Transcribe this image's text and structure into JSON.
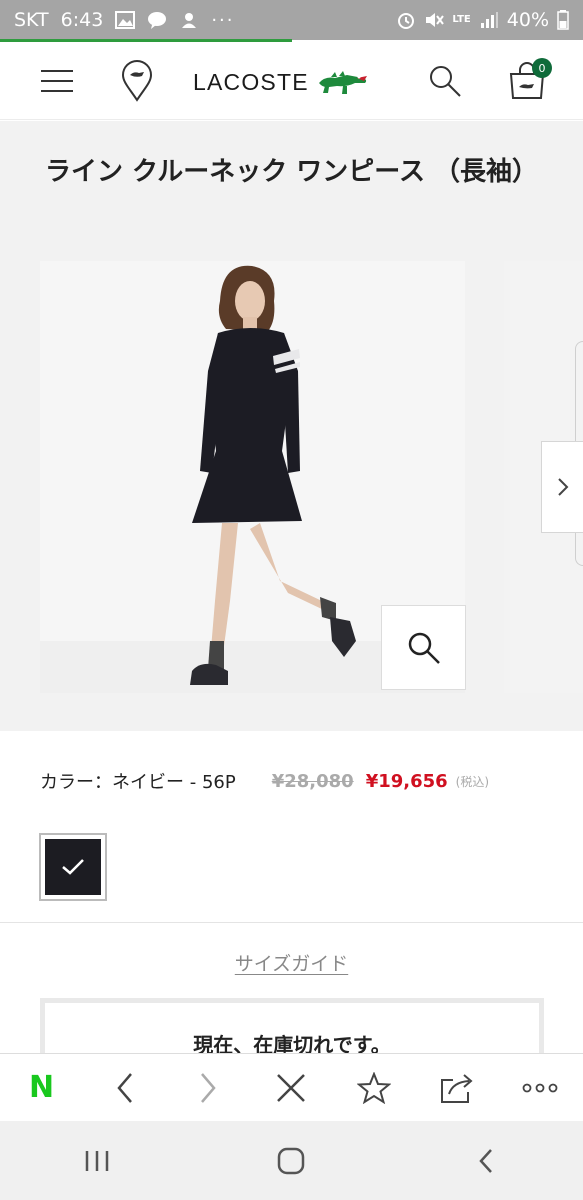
{
  "status_bar": {
    "carrier": "SKT",
    "time": "6:43",
    "battery": "40%",
    "network": "LTE"
  },
  "header": {
    "brand": "LACOSTE",
    "cart_count": "0",
    "icons": [
      "menu-icon",
      "store-locator-icon",
      "search-icon",
      "cart-icon"
    ]
  },
  "product": {
    "title": "ライン クルーネック ワンピース （長袖）",
    "color_label": "カラー：ネイビー - 56P",
    "price_original": "¥28,080",
    "price_sale": "¥19,656",
    "tax_note": "(税込)",
    "swatch_color": "#1c1c22"
  },
  "size_guide": "サイズガイド",
  "stock_message": "現在、在庫切れです。",
  "colors": {
    "accent": "#2e9c3e",
    "sale": "#d01020",
    "badge": "#0f6b3a"
  },
  "toolbar": {
    "home": "N"
  }
}
